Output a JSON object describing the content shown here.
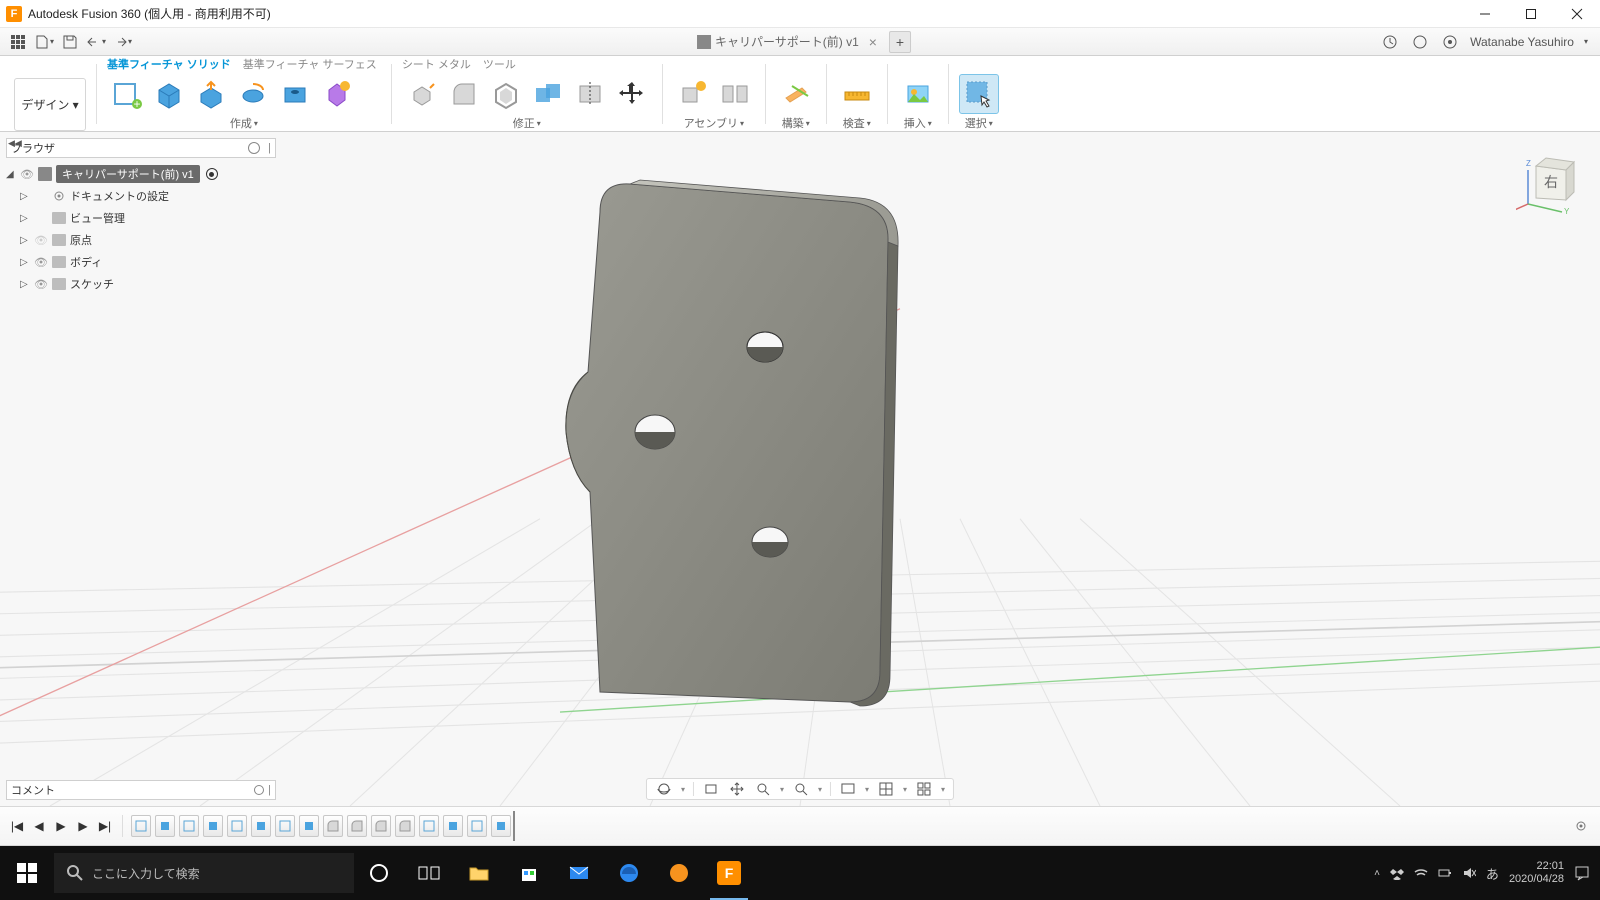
{
  "title": {
    "app": "Autodesk Fusion 360 (個人用 - 商用利用不可)"
  },
  "document": {
    "name": "キャリパーサポート(前) v1"
  },
  "user": {
    "name": "Watanabe Yasuhiro"
  },
  "ribbon": {
    "design_label": "デザイン ▾",
    "tabs": {
      "solid": "基準フィーチャ ソリッド",
      "surface": "基準フィーチャ サーフェス",
      "sheetmetal": "シート メタル",
      "tools": "ツール"
    },
    "groups": {
      "create": "作成",
      "modify": "修正",
      "assemble": "アセンブリ",
      "construct": "構築",
      "inspect": "検査",
      "insert": "挿入",
      "select": "選択"
    }
  },
  "browser": {
    "title": "ブラウザ",
    "root": "キャリパーサポート(前) v1",
    "items": [
      {
        "label": "ドキュメントの設定",
        "icon": "gear"
      },
      {
        "label": "ビュー管理",
        "icon": "folder"
      },
      {
        "label": "原点",
        "icon": "folder",
        "eye": true
      },
      {
        "label": "ボディ",
        "icon": "folder",
        "eye": true
      },
      {
        "label": "スケッチ",
        "icon": "folder",
        "eye": true
      }
    ]
  },
  "comments": {
    "label": "コメント"
  },
  "viewcube": {
    "face": "右"
  },
  "taskbar": {
    "search_placeholder": "ここに入力して検索",
    "time": "22:01",
    "date": "2020/04/28"
  }
}
